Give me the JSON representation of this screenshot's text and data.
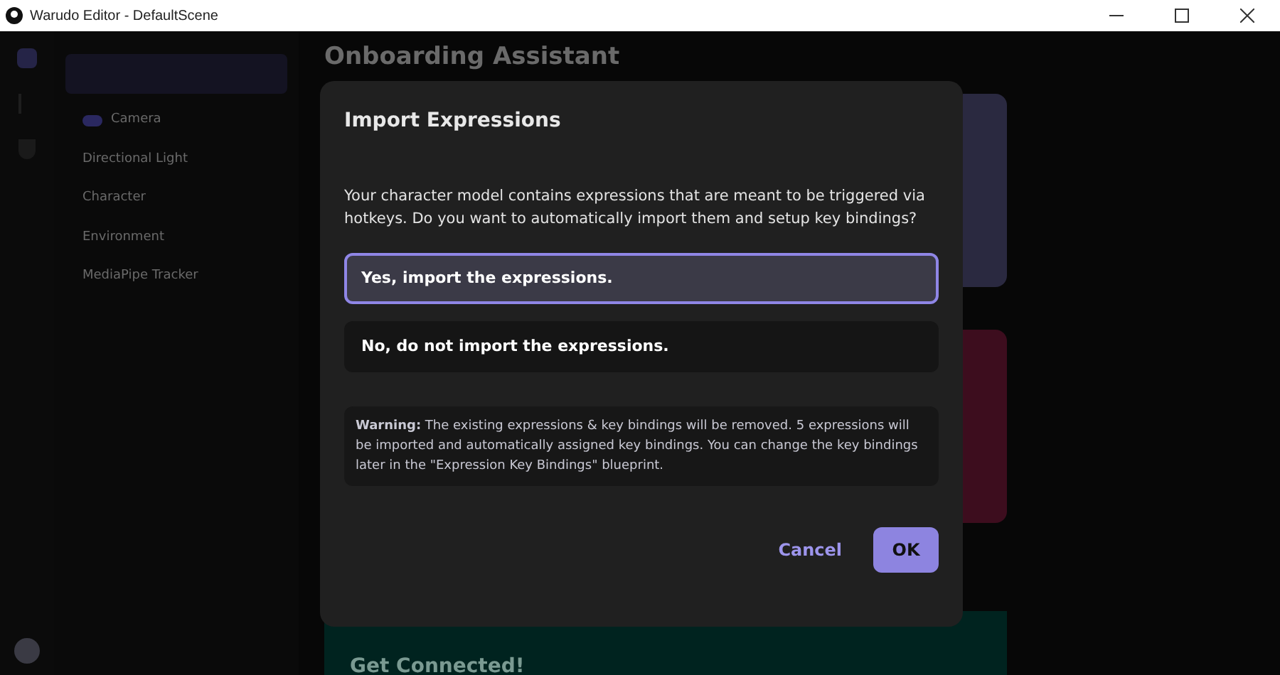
{
  "window": {
    "title": "Warudo Editor - DefaultScene"
  },
  "sidebar": {
    "items": [
      {
        "label": "Camera",
        "kind": "object"
      },
      {
        "label": "Directional Light",
        "kind": "plain"
      },
      {
        "label": "Character",
        "kind": "plain"
      },
      {
        "label": "Environment",
        "kind": "plain"
      },
      {
        "label": "MediaPipe Tracker",
        "kind": "plain"
      }
    ]
  },
  "main": {
    "heading": "Onboarding Assistant",
    "cards": [
      {
        "color": "#2a2940"
      },
      {
        "color": "#3d0d1e"
      },
      {
        "color": "#00231f",
        "title": "Get Connected!"
      }
    ]
  },
  "dialog": {
    "title": "Import Expressions",
    "message": "Your character model contains expressions that are meant to be triggered via hotkeys. Do you want to automatically import them and setup key bindings?",
    "options": [
      {
        "label": "Yes, import the expressions.",
        "selected": true
      },
      {
        "label": "No, do not import the expressions.",
        "selected": false
      }
    ],
    "warning": "**Warning:** The existing expressions & key bindings will be removed. 5 expressions will be imported and automatically assigned key bindings. You can change the key bindings later in the \"Expression Key Bindings\" blueprint.",
    "buttons": [
      {
        "label": "Cancel",
        "kind": "text"
      },
      {
        "label": "OK",
        "kind": "primary"
      }
    ]
  }
}
